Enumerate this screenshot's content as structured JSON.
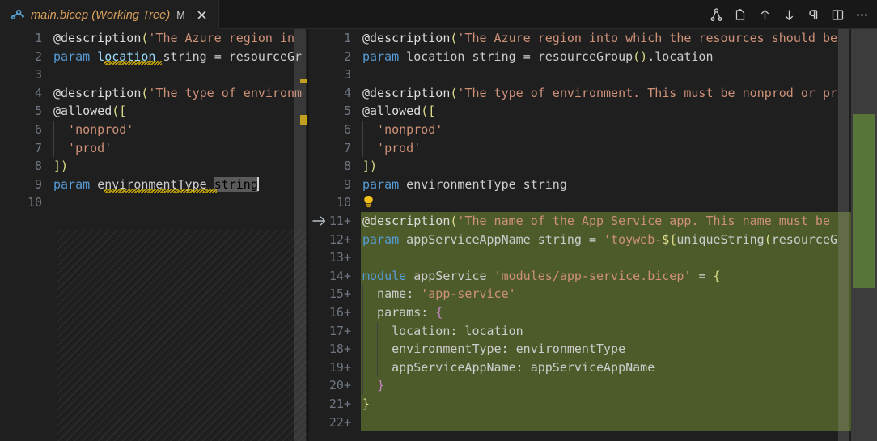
{
  "window": {
    "background": "#181818",
    "editor_background": "#1f1f1f"
  },
  "tab": {
    "icon": "bicep-file-icon",
    "label": "main.bicep (Working Tree)",
    "badge": "M",
    "close_icon": "close-icon",
    "label_color": "#d9a05b"
  },
  "toolbar": {
    "buttons": [
      {
        "name": "compare-changes-icon",
        "title": "Open Changes"
      },
      {
        "name": "open-file-icon",
        "title": "Open File"
      },
      {
        "name": "previous-change-icon",
        "title": "Previous Change"
      },
      {
        "name": "next-change-icon",
        "title": "Next Change"
      },
      {
        "name": "whitespace-pilcrow-icon",
        "title": "Toggle Whitespace"
      },
      {
        "name": "split-editor-icon",
        "title": "Split Editor"
      },
      {
        "name": "more-actions-icon",
        "title": "More Actions..."
      }
    ]
  },
  "diff": {
    "added_background": "#4d5b2b",
    "gutter_number_color": "#6e7681",
    "left": {
      "lines": [
        {
          "n": "1",
          "tokens": [
            {
              "c": "t-decor",
              "t": "@description"
            },
            {
              "c": "t-yellow",
              "t": "("
            },
            {
              "c": "t-str",
              "t": "'The Azure region in"
            }
          ]
        },
        {
          "n": "2",
          "tokens": [
            {
              "c": "t-key",
              "t": "param"
            },
            {
              "c": "t-default",
              "t": " "
            },
            {
              "c": "t-var",
              "t": "location"
            },
            {
              "c": "t-default",
              "t": " string "
            },
            {
              "c": "t-punct",
              "t": "="
            },
            {
              "c": "t-default",
              "t": " resourceGr"
            }
          ]
        },
        {
          "n": "3",
          "tokens": []
        },
        {
          "n": "4",
          "tokens": [
            {
              "c": "t-decor",
              "t": "@description"
            },
            {
              "c": "t-yellow",
              "t": "("
            },
            {
              "c": "t-str",
              "t": "'The type of environm"
            }
          ]
        },
        {
          "n": "5",
          "tokens": [
            {
              "c": "t-decor",
              "t": "@allowed"
            },
            {
              "c": "t-yellow",
              "t": "(["
            }
          ]
        },
        {
          "n": "6",
          "tokens": [
            {
              "c": "t-str",
              "t": "  'nonprod'"
            }
          ]
        },
        {
          "n": "7",
          "tokens": [
            {
              "c": "t-str",
              "t": "  'prod'"
            }
          ]
        },
        {
          "n": "8",
          "tokens": [
            {
              "c": "t-yellow",
              "t": "])"
            }
          ]
        },
        {
          "n": "9",
          "tokens": [
            {
              "c": "t-key",
              "t": "param"
            },
            {
              "c": "t-default",
              "t": " "
            },
            {
              "c": "t-default",
              "t": "environmentType"
            },
            {
              "c": "t-default",
              "t": " "
            }
          ],
          "selection": "string",
          "caret": true
        },
        {
          "n": "10",
          "tokens": []
        }
      ]
    },
    "right": {
      "lines": [
        {
          "n": "1",
          "added": false,
          "tokens": [
            {
              "c": "t-decor",
              "t": "@description"
            },
            {
              "c": "t-yellow",
              "t": "("
            },
            {
              "c": "t-str",
              "t": "'The Azure region into which the resources should be"
            }
          ]
        },
        {
          "n": "2",
          "added": false,
          "tokens": [
            {
              "c": "t-key",
              "t": "param"
            },
            {
              "c": "t-default",
              "t": " location string "
            },
            {
              "c": "t-punct",
              "t": "="
            },
            {
              "c": "t-default",
              "t": " resourceGroup"
            },
            {
              "c": "t-yellow",
              "t": "()"
            },
            {
              "c": "t-default",
              "t": ".location"
            }
          ]
        },
        {
          "n": "3",
          "added": false,
          "tokens": []
        },
        {
          "n": "4",
          "added": false,
          "tokens": [
            {
              "c": "t-decor",
              "t": "@description"
            },
            {
              "c": "t-yellow",
              "t": "("
            },
            {
              "c": "t-str",
              "t": "'The type of environment. This must be nonprod or pr"
            }
          ]
        },
        {
          "n": "5",
          "added": false,
          "tokens": [
            {
              "c": "t-decor",
              "t": "@allowed"
            },
            {
              "c": "t-yellow",
              "t": "(["
            }
          ]
        },
        {
          "n": "6",
          "added": false,
          "tokens": [
            {
              "c": "t-str",
              "t": "  'nonprod'"
            }
          ]
        },
        {
          "n": "7",
          "added": false,
          "tokens": [
            {
              "c": "t-str",
              "t": "  'prod'"
            }
          ]
        },
        {
          "n": "8",
          "added": false,
          "tokens": [
            {
              "c": "t-yellow",
              "t": "])"
            }
          ]
        },
        {
          "n": "9",
          "added": false,
          "tokens": [
            {
              "c": "t-key",
              "t": "param"
            },
            {
              "c": "t-default",
              "t": " environmentType string"
            }
          ]
        },
        {
          "n": "10",
          "added": false,
          "tokens": [],
          "lightbulb": true
        },
        {
          "n": "11",
          "added": true,
          "marker": true,
          "tokens": [
            {
              "c": "t-decor",
              "t": "@description"
            },
            {
              "c": "t-yellow",
              "t": "("
            },
            {
              "c": "t-str",
              "t": "'The name of the App Service app. This name must be"
            }
          ]
        },
        {
          "n": "12",
          "added": true,
          "tokens": [
            {
              "c": "t-key",
              "t": "param"
            },
            {
              "c": "t-default",
              "t": " appServiceAppName string "
            },
            {
              "c": "t-punct",
              "t": "="
            },
            {
              "c": "t-default",
              "t": " "
            },
            {
              "c": "t-str",
              "t": "'toyweb-"
            },
            {
              "c": "t-yellow",
              "t": "${"
            },
            {
              "c": "t-default",
              "t": "uniqueString"
            },
            {
              "c": "t-yellow",
              "t": "("
            },
            {
              "c": "t-default",
              "t": "resourceG"
            }
          ]
        },
        {
          "n": "13",
          "added": true,
          "tokens": []
        },
        {
          "n": "14",
          "added": true,
          "tokens": [
            {
              "c": "t-key",
              "t": "module"
            },
            {
              "c": "t-default",
              "t": " appService "
            },
            {
              "c": "t-str",
              "t": "'modules/app-service.bicep'"
            },
            {
              "c": "t-default",
              "t": " "
            },
            {
              "c": "t-punct",
              "t": "="
            },
            {
              "c": "t-default",
              "t": " "
            },
            {
              "c": "t-yellow",
              "t": "{"
            }
          ]
        },
        {
          "n": "15",
          "added": true,
          "tokens": [
            {
              "c": "t-prop",
              "t": "  name"
            },
            {
              "c": "t-punct",
              "t": ":"
            },
            {
              "c": "t-default",
              "t": " "
            },
            {
              "c": "t-str",
              "t": "'app-service'"
            }
          ]
        },
        {
          "n": "16",
          "added": true,
          "tokens": [
            {
              "c": "t-prop",
              "t": "  params"
            },
            {
              "c": "t-punct",
              "t": ":"
            },
            {
              "c": "t-default",
              "t": " "
            },
            {
              "c": "t-magenta",
              "t": "{"
            }
          ]
        },
        {
          "n": "17",
          "added": true,
          "tokens": [
            {
              "c": "t-prop",
              "t": "    location"
            },
            {
              "c": "t-punct",
              "t": ":"
            },
            {
              "c": "t-default",
              "t": " location"
            }
          ]
        },
        {
          "n": "18",
          "added": true,
          "tokens": [
            {
              "c": "t-prop",
              "t": "    environmentType"
            },
            {
              "c": "t-punct",
              "t": ":"
            },
            {
              "c": "t-default",
              "t": " environmentType"
            }
          ]
        },
        {
          "n": "19",
          "added": true,
          "tokens": [
            {
              "c": "t-prop",
              "t": "    appServiceAppName"
            },
            {
              "c": "t-punct",
              "t": ":"
            },
            {
              "c": "t-default",
              "t": " appServiceAppName"
            }
          ]
        },
        {
          "n": "20",
          "added": true,
          "tokens": [
            {
              "c": "t-default",
              "t": "  "
            },
            {
              "c": "t-magenta",
              "t": "}"
            }
          ]
        },
        {
          "n": "21",
          "added": true,
          "tokens": [
            {
              "c": "t-yellow",
              "t": "}"
            }
          ]
        },
        {
          "n": "22",
          "added": true,
          "tokens": []
        }
      ]
    }
  }
}
